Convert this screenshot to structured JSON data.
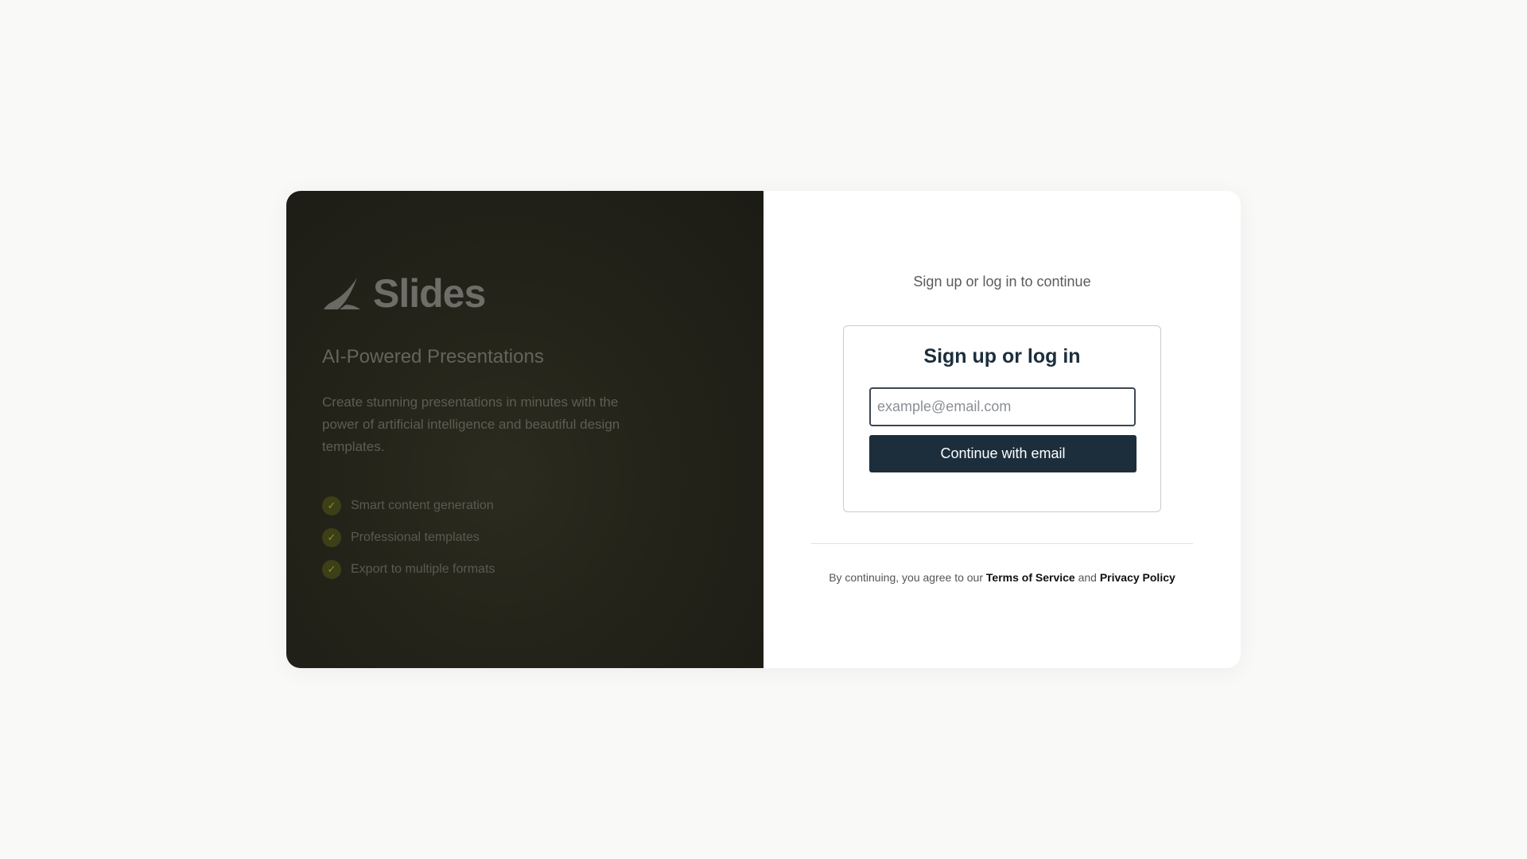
{
  "brand": {
    "name": "Slides",
    "logo_icon": "sail-logo-icon",
    "tagline": "AI-Powered Presentations",
    "description": "Create stunning presentations in minutes with the power of artificial intelligence and beautiful design templates.",
    "features": [
      "Smart content generation",
      "Professional templates",
      "Export to multiple formats"
    ],
    "feature_icon": "check-icon",
    "feature_icon_glyph": "✓"
  },
  "auth": {
    "subtitle": "Sign up or log in to continue",
    "title": "Sign up or log in",
    "email_placeholder": "example@email.com",
    "email_value": "",
    "continue_label": "Continue with email",
    "legal_prefix": "By continuing, you agree to our",
    "terms_label": "Terms of Service",
    "legal_and": "and",
    "privacy_label": "Privacy Policy"
  },
  "colors": {
    "page_background": "#f9f9f8",
    "brand_panel_background": "#232319",
    "primary_button": "#1c2e3c",
    "check_badge": "#3d3f17"
  }
}
